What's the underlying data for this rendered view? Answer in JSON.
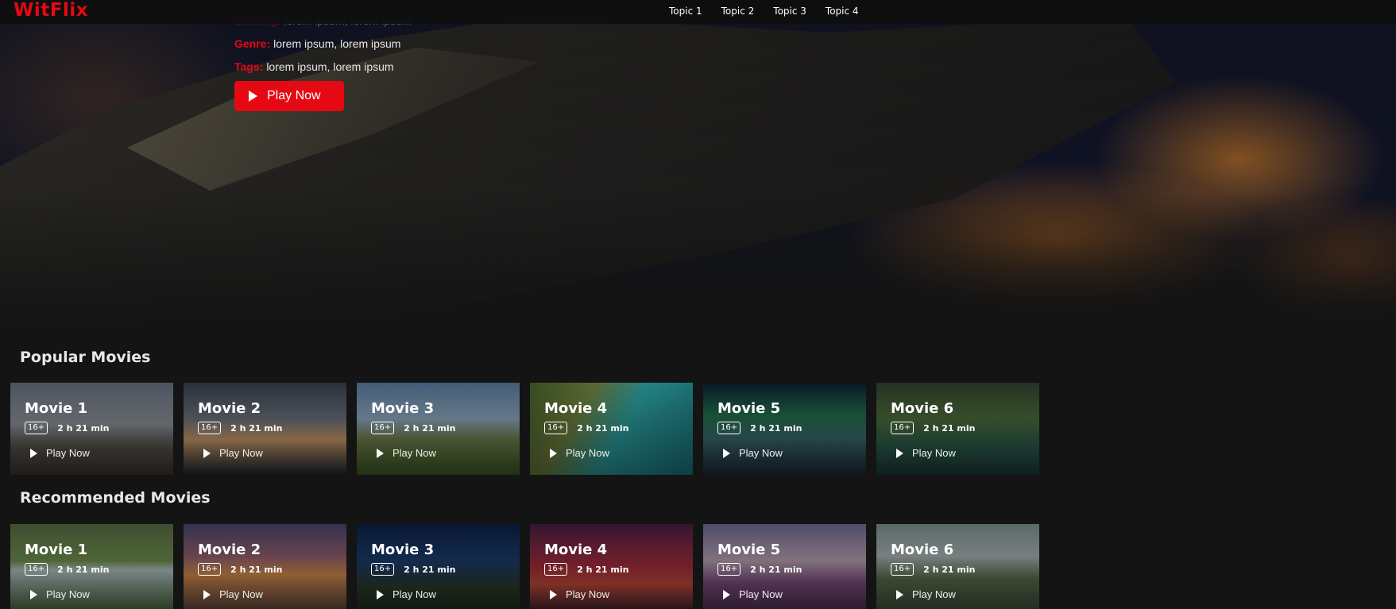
{
  "brand": {
    "logo": "WitFlix",
    "accent": "#e50914"
  },
  "nav": {
    "links": [
      "Topic 1",
      "Topic 2",
      "Topic 3",
      "Topic 4"
    ]
  },
  "hero": {
    "starring_label": "Starring:",
    "starring_value": "lorem ipsum, lorem ipsum",
    "genre_label": "Genre:",
    "genre_value": "lorem ipsum, lorem ipsum",
    "tags_label": "Tags:",
    "tags_value": "lorem ipsum, lorem ipsum",
    "play_label": "Play Now"
  },
  "sections": [
    {
      "title": "Popular Movies",
      "cards": [
        {
          "title": "Movie 1",
          "rating": "16+",
          "duration": "2 h 21 min",
          "play": "Play Now",
          "bg": "linear-gradient(180deg,#5a6270 0%,#8a8f96 45%,#56504a 70%,#3a3530 100%)"
        },
        {
          "title": "Movie 2",
          "rating": "16+",
          "duration": "2 h 21 min",
          "play": "Play Now",
          "bg": "linear-gradient(180deg,#2e3846 0%,#6a6f78 40%,#c99a6a 62%,#1c2530 100%)"
        },
        {
          "title": "Movie 3",
          "rating": "16+",
          "duration": "2 h 21 min",
          "play": "Play Now",
          "bg": "linear-gradient(180deg,#4d6b8c 0%,#8aa3b8 40%,#6f7d4a 62%,#3c5a22 100%)"
        },
        {
          "title": "Movie 4",
          "rating": "16+",
          "duration": "2 h 21 min",
          "play": "Play Now",
          "bg": "linear-gradient(120deg,#3f5a2a 0%,#6a7a3a 30%,#2a9a9a 55%,#18707a 100%)"
        },
        {
          "title": "Movie 5",
          "rating": "16+",
          "duration": "2 h 21 min",
          "play": "Play Now",
          "bg": "linear-gradient(180deg,#0b1a2a 0%,#1f6a4a 35%,#3a6a6a 60%,#1a2a3a 100%)"
        },
        {
          "title": "Movie 6",
          "rating": "16+",
          "duration": "2 h 21 min",
          "play": "Play Now",
          "bg": "linear-gradient(180deg,#2a3a2a 0%,#4a6a3a 40%,#2a5a4a 70%,#1a3a3a 100%)"
        }
      ]
    },
    {
      "title": "Recommended Movies",
      "cards": [
        {
          "title": "Movie 1",
          "rating": "16+",
          "duration": "2 h 21 min",
          "play": "Play Now",
          "bg": "linear-gradient(180deg,#4a5a3a 0%,#6a8a4a 40%,#b0c0c0 50%,#3a5a2a 100%)"
        },
        {
          "title": "Movie 2",
          "rating": "16+",
          "duration": "2 h 21 min",
          "play": "Play Now",
          "bg": "linear-gradient(180deg,#3a3a5a 0%,#8a5a6a 35%,#d08a4a 55%,#4a3a3a 100%)"
        },
        {
          "title": "Movie 3",
          "rating": "16+",
          "duration": "2 h 21 min",
          "play": "Play Now",
          "bg": "linear-gradient(180deg,#0a1a3a 0%,#1a3a6a 40%,#2a3a2a 70%,#1a2a1a 100%)"
        },
        {
          "title": "Movie 4",
          "rating": "16+",
          "duration": "2 h 21 min",
          "play": "Play Now",
          "bg": "linear-gradient(180deg,#3a1a3a 0%,#a02a3a 45%,#c04a3a 65%,#2a1a2a 100%)"
        },
        {
          "title": "Movie 5",
          "rating": "16+",
          "duration": "2 h 21 min",
          "play": "Play Now",
          "bg": "linear-gradient(180deg,#5a5a7a 0%,#b09aaa 40%,#7a4a7a 65%,#4a2a4a 100%)"
        },
        {
          "title": "Movie 6",
          "rating": "16+",
          "duration": "2 h 21 min",
          "play": "Play Now",
          "bg": "linear-gradient(180deg,#6a7a7a 0%,#a0aaaa 35%,#5a6a4a 60%,#3a4a3a 100%)"
        }
      ]
    }
  ]
}
